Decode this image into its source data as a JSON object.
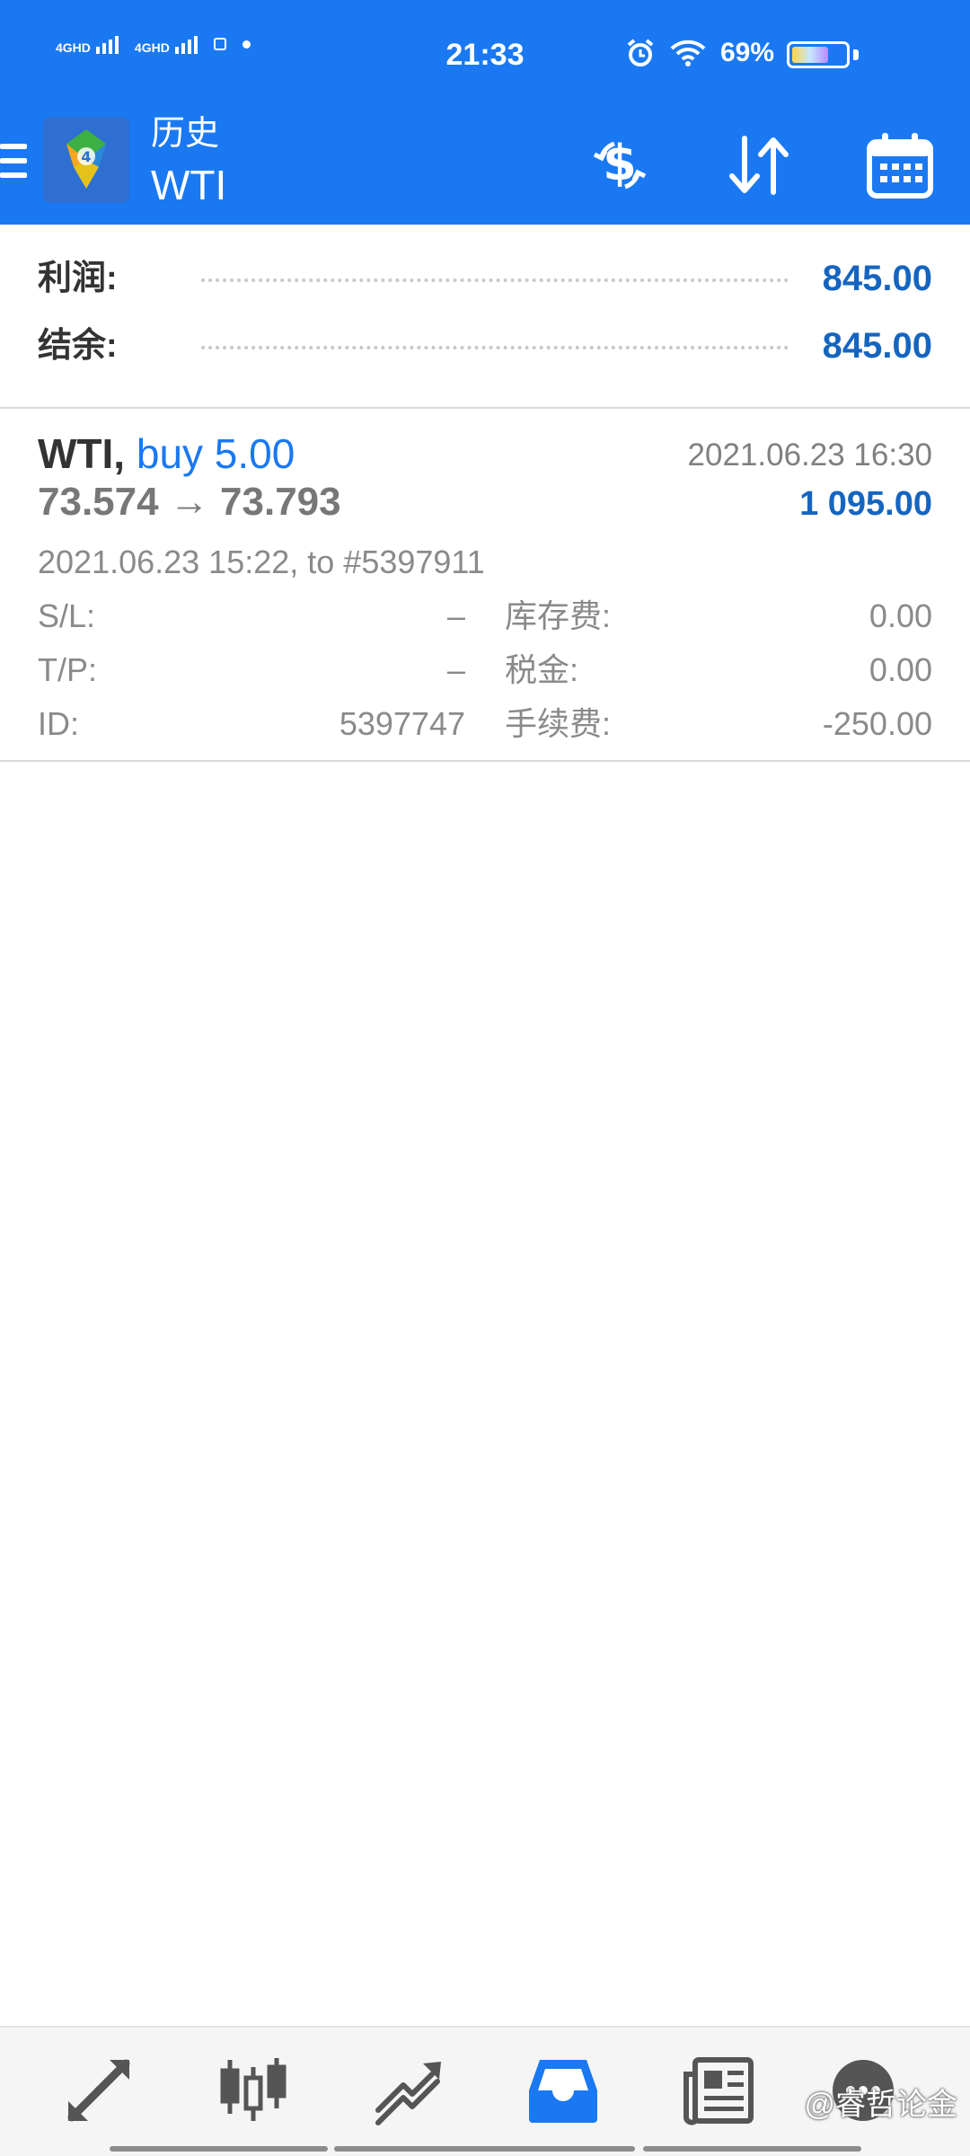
{
  "status_bar": {
    "sim1": "4GHD",
    "sim2": "4GHD",
    "time": "21:33",
    "battery": "69%"
  },
  "toolbar": {
    "title": "历史",
    "subtitle": "WTI"
  },
  "summary": {
    "profit_label": "利润:",
    "profit_value": "845.00",
    "balance_label": "结余:",
    "balance_value": "845.00"
  },
  "deal": {
    "symbol": "WTI,",
    "type": "buy 5.00",
    "prices": "73.574 → 73.793",
    "close_time": "2021.06.23 16:30",
    "profit": "1 095.00",
    "open_info": "2021.06.23 15:22, to #5397911",
    "sl_label": "S/L:",
    "sl_value": "–",
    "tp_label": "T/P:",
    "tp_value": "–",
    "id_label": "ID:",
    "id_value": "5397747",
    "swap_label": "库存费:",
    "swap_value": "0.00",
    "tax_label": "税金:",
    "tax_value": "0.00",
    "commission_label": "手续费:",
    "commission_value": "-250.00"
  },
  "bottom_nav": {
    "items": [
      "quotes-icon",
      "chart-icon",
      "trade-icon",
      "history-icon",
      "news-icon",
      "chat-icon"
    ],
    "active": "history-icon",
    "accent": "#1a79f2"
  },
  "watermark": "@睿哲论金"
}
